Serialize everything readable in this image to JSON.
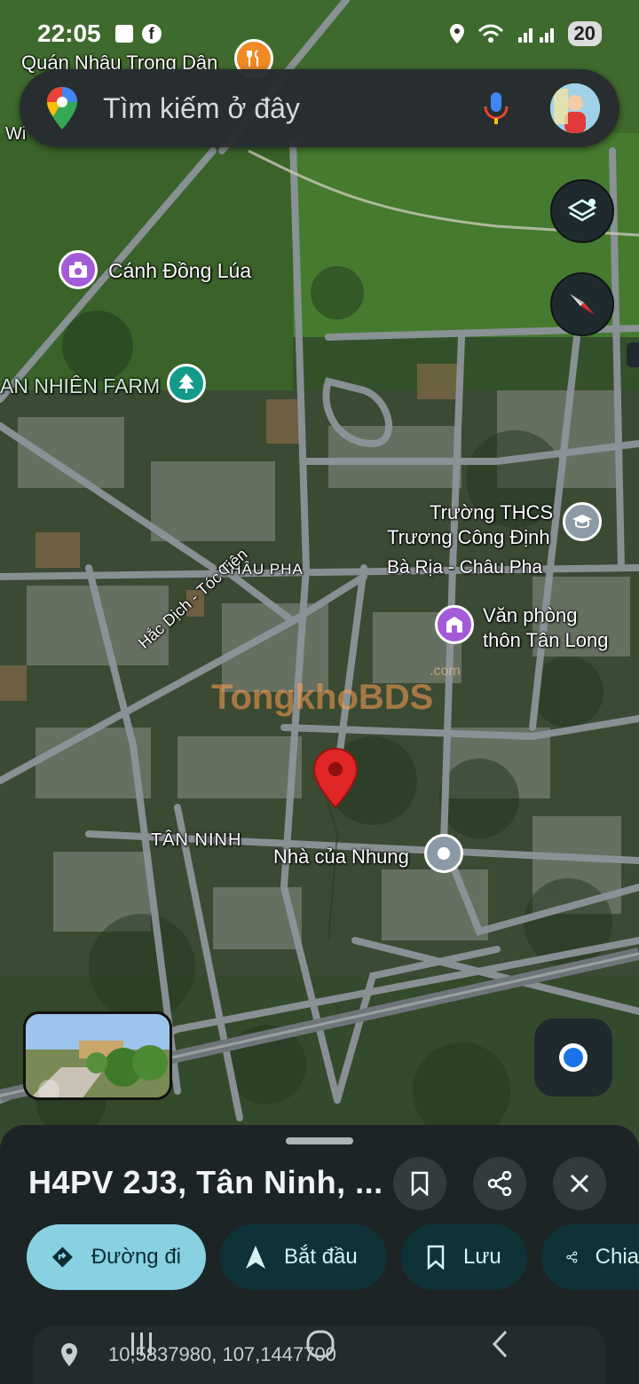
{
  "status": {
    "time": "22:05",
    "battery": "20"
  },
  "search": {
    "placeholder": "Tìm kiếm ở đây"
  },
  "map_labels": {
    "quan_nhau": "Quán Nhậu Trọng Dân",
    "wi": "Wi",
    "canh_dong_lua": "Cánh Đồng Lúa",
    "an_nhien_farm": "AN NHIÊN FARM",
    "truong_line1": "Trường THCS",
    "truong_line2": "Trương Công Định",
    "chau_pha": "CHÂU PHA",
    "ba_ria": "Bà Rịa - Châu Pha",
    "van_phong_line1": "Văn phòng",
    "van_phong_line2": "thôn Tân Long",
    "hac_dich": "Hắc Dịch - Tóc Tiên",
    "tan_ninh": "TÂN NINH",
    "nha_cua_nhung": "Nhà của Nhung",
    "watermark": "TongkhoBDS",
    "watermark_small": ".com"
  },
  "place": {
    "title": "H4PV 2J3, Tân Ninh, ..."
  },
  "actions": {
    "directions": "Đường đi",
    "start": "Bắt đầu",
    "save": "Lưu",
    "share": "Chia"
  },
  "coordinates": "10,5837980, 107,1447700",
  "colors": {
    "accent_chip": "#87d1e3",
    "pin_red": "#e02626",
    "poi_purple": "#a35bd8",
    "poi_teal": "#139b8a",
    "poi_orange": "#f08a24",
    "poi_grey": "#8a9aa6"
  }
}
